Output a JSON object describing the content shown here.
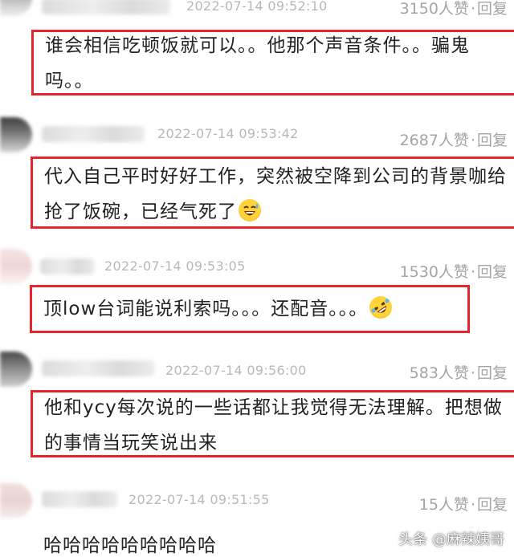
{
  "comments": [
    {
      "time": "2022-07-14 09:52:10",
      "likes": "3150人赞",
      "reply": "回复",
      "text": "谁会相信吃顿饭就可以。。他那个声音条件。。骗鬼吗。。"
    },
    {
      "time": "2022-07-14 09:53:42",
      "likes": "2687人赞",
      "reply": "回复",
      "text": "代入自己平时好好工作，突然被空降到公司的背景咖给抢了饭碗，已经气死了",
      "emoji": "sweat-smile-emoji"
    },
    {
      "time": "2022-07-14 09:53:05",
      "likes": "1530人赞",
      "reply": "回复",
      "text": "顶low台词能说利索吗。。。还配音。。。",
      "emoji": "rolling-laugh-emoji"
    },
    {
      "time": "2022-07-14 09:56:00",
      "likes": "583人赞",
      "reply": "回复",
      "text": "他和ycy每次说的一些话都让我觉得无法理解。把想做的事情当玩笑说出来"
    },
    {
      "time": "2022-07-14 09:51:55",
      "likes": "15人赞",
      "reply": "回复",
      "text": "哈哈哈哈哈哈哈哈哈"
    }
  ],
  "separator": "·",
  "watermark": "头条 @麻辣姨哥",
  "colors": {
    "highlight_border": "#e5242c",
    "meta_text": "#b8b8b8",
    "action_text": "#a4a4a4",
    "body_text": "#222222"
  }
}
